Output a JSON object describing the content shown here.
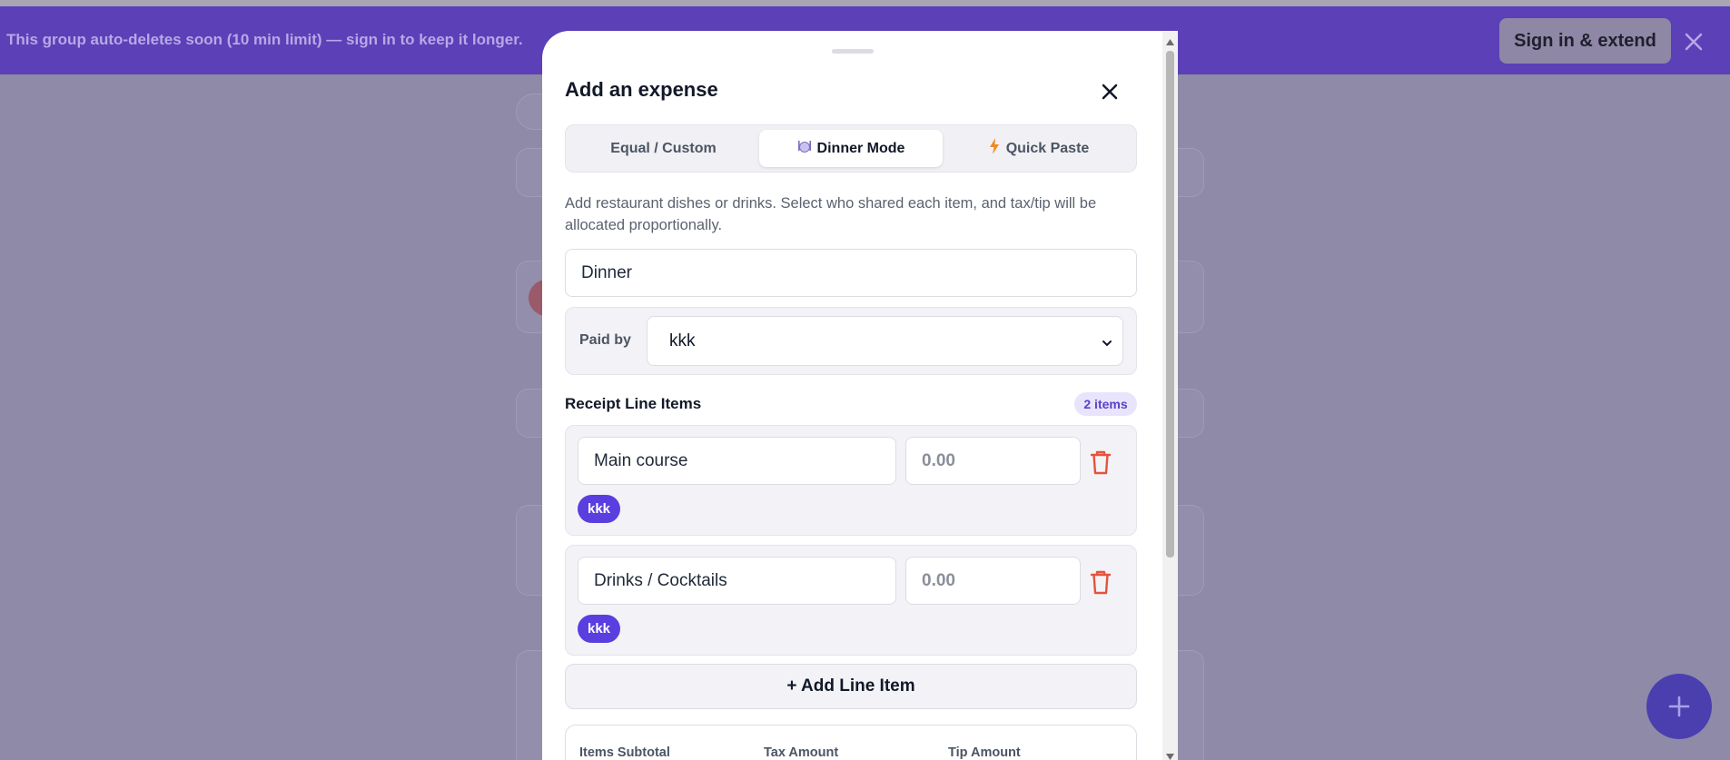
{
  "banner": {
    "message": "This group auto-deletes soon (10 min limit) — sign in to keep it longer.",
    "action_label": "Sign in & extend",
    "close_icon": "close-icon"
  },
  "modal": {
    "title": "Add an expense",
    "tabs": [
      {
        "label": "Equal / Custom",
        "icon": "",
        "active": false
      },
      {
        "label": "Dinner Mode",
        "icon": "dinner-plate-icon",
        "active": true
      },
      {
        "label": "Quick Paste",
        "icon": "lightning-icon",
        "active": false
      }
    ],
    "description": "Add restaurant dishes or drinks. Select who shared each item, and tax/tip will be allocated proportionally.",
    "expense_name": "Dinner",
    "paid_by_label": "Paid by",
    "paid_by_value": "kkk",
    "line_items_title": "Receipt Line Items",
    "line_items_count": "2 items",
    "line_items": [
      {
        "name": "Main course",
        "amount_placeholder": "0.00",
        "participants": [
          "kkk"
        ]
      },
      {
        "name": "Drinks / Cocktails",
        "amount_placeholder": "0.00",
        "participants": [
          "kkk"
        ]
      }
    ],
    "add_line_label": "+ Add Line Item",
    "totals": {
      "subtotal_label": "Items Subtotal",
      "tax_label": "Tax Amount",
      "tip_label": "Tip Amount"
    }
  },
  "colors": {
    "accent": "#5b3ee0",
    "banner": "#5b40b8",
    "danger": "#e5533d"
  }
}
